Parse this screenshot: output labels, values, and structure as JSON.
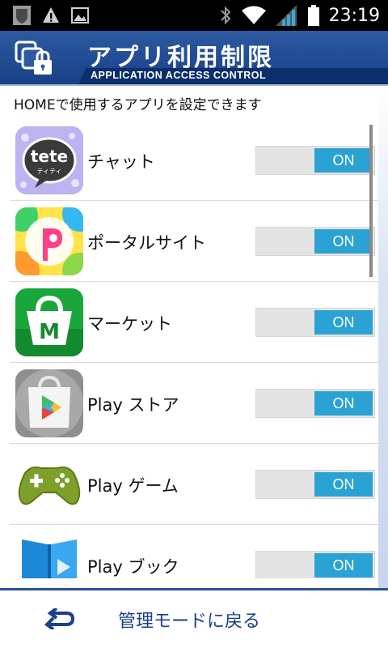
{
  "status_bar": {
    "time": "23:19",
    "icons": [
      "shield-notification-icon",
      "warning-icon",
      "image-icon",
      "bluetooth-icon",
      "wifi-icon",
      "signal-icon",
      "battery-icon"
    ]
  },
  "header": {
    "title": "アプリ利用制限",
    "subtitle": "APPLICATION ACCESS CONTROL",
    "logo_icon": "app-lock-icon"
  },
  "description": "HOMEで使用するアプリを設定できます",
  "apps": [
    {
      "label": "チャット",
      "icon": "tete-chat-icon",
      "toggle": "ON"
    },
    {
      "label": "ポータルサイト",
      "icon": "portal-p-icon",
      "toggle": "ON"
    },
    {
      "label": "マーケット",
      "icon": "market-bag-icon",
      "toggle": "ON"
    },
    {
      "label": "Play ストア",
      "icon": "play-store-icon",
      "toggle": "ON"
    },
    {
      "label": "Play ゲーム",
      "icon": "play-games-icon",
      "toggle": "ON"
    },
    {
      "label": "Play ブック",
      "icon": "play-books-icon",
      "toggle": "ON"
    }
  ],
  "icon_texts": {
    "tete": "tete",
    "tete_kana": "ティティ",
    "market_letter": "M"
  },
  "footer": {
    "back_label": "管理モードに戻る",
    "back_icon": "return-arrow-icon"
  },
  "colors": {
    "header_blue": "#1f4a94",
    "toggle_on": "#2aa2d3",
    "footer_text": "#1b3f8a"
  }
}
